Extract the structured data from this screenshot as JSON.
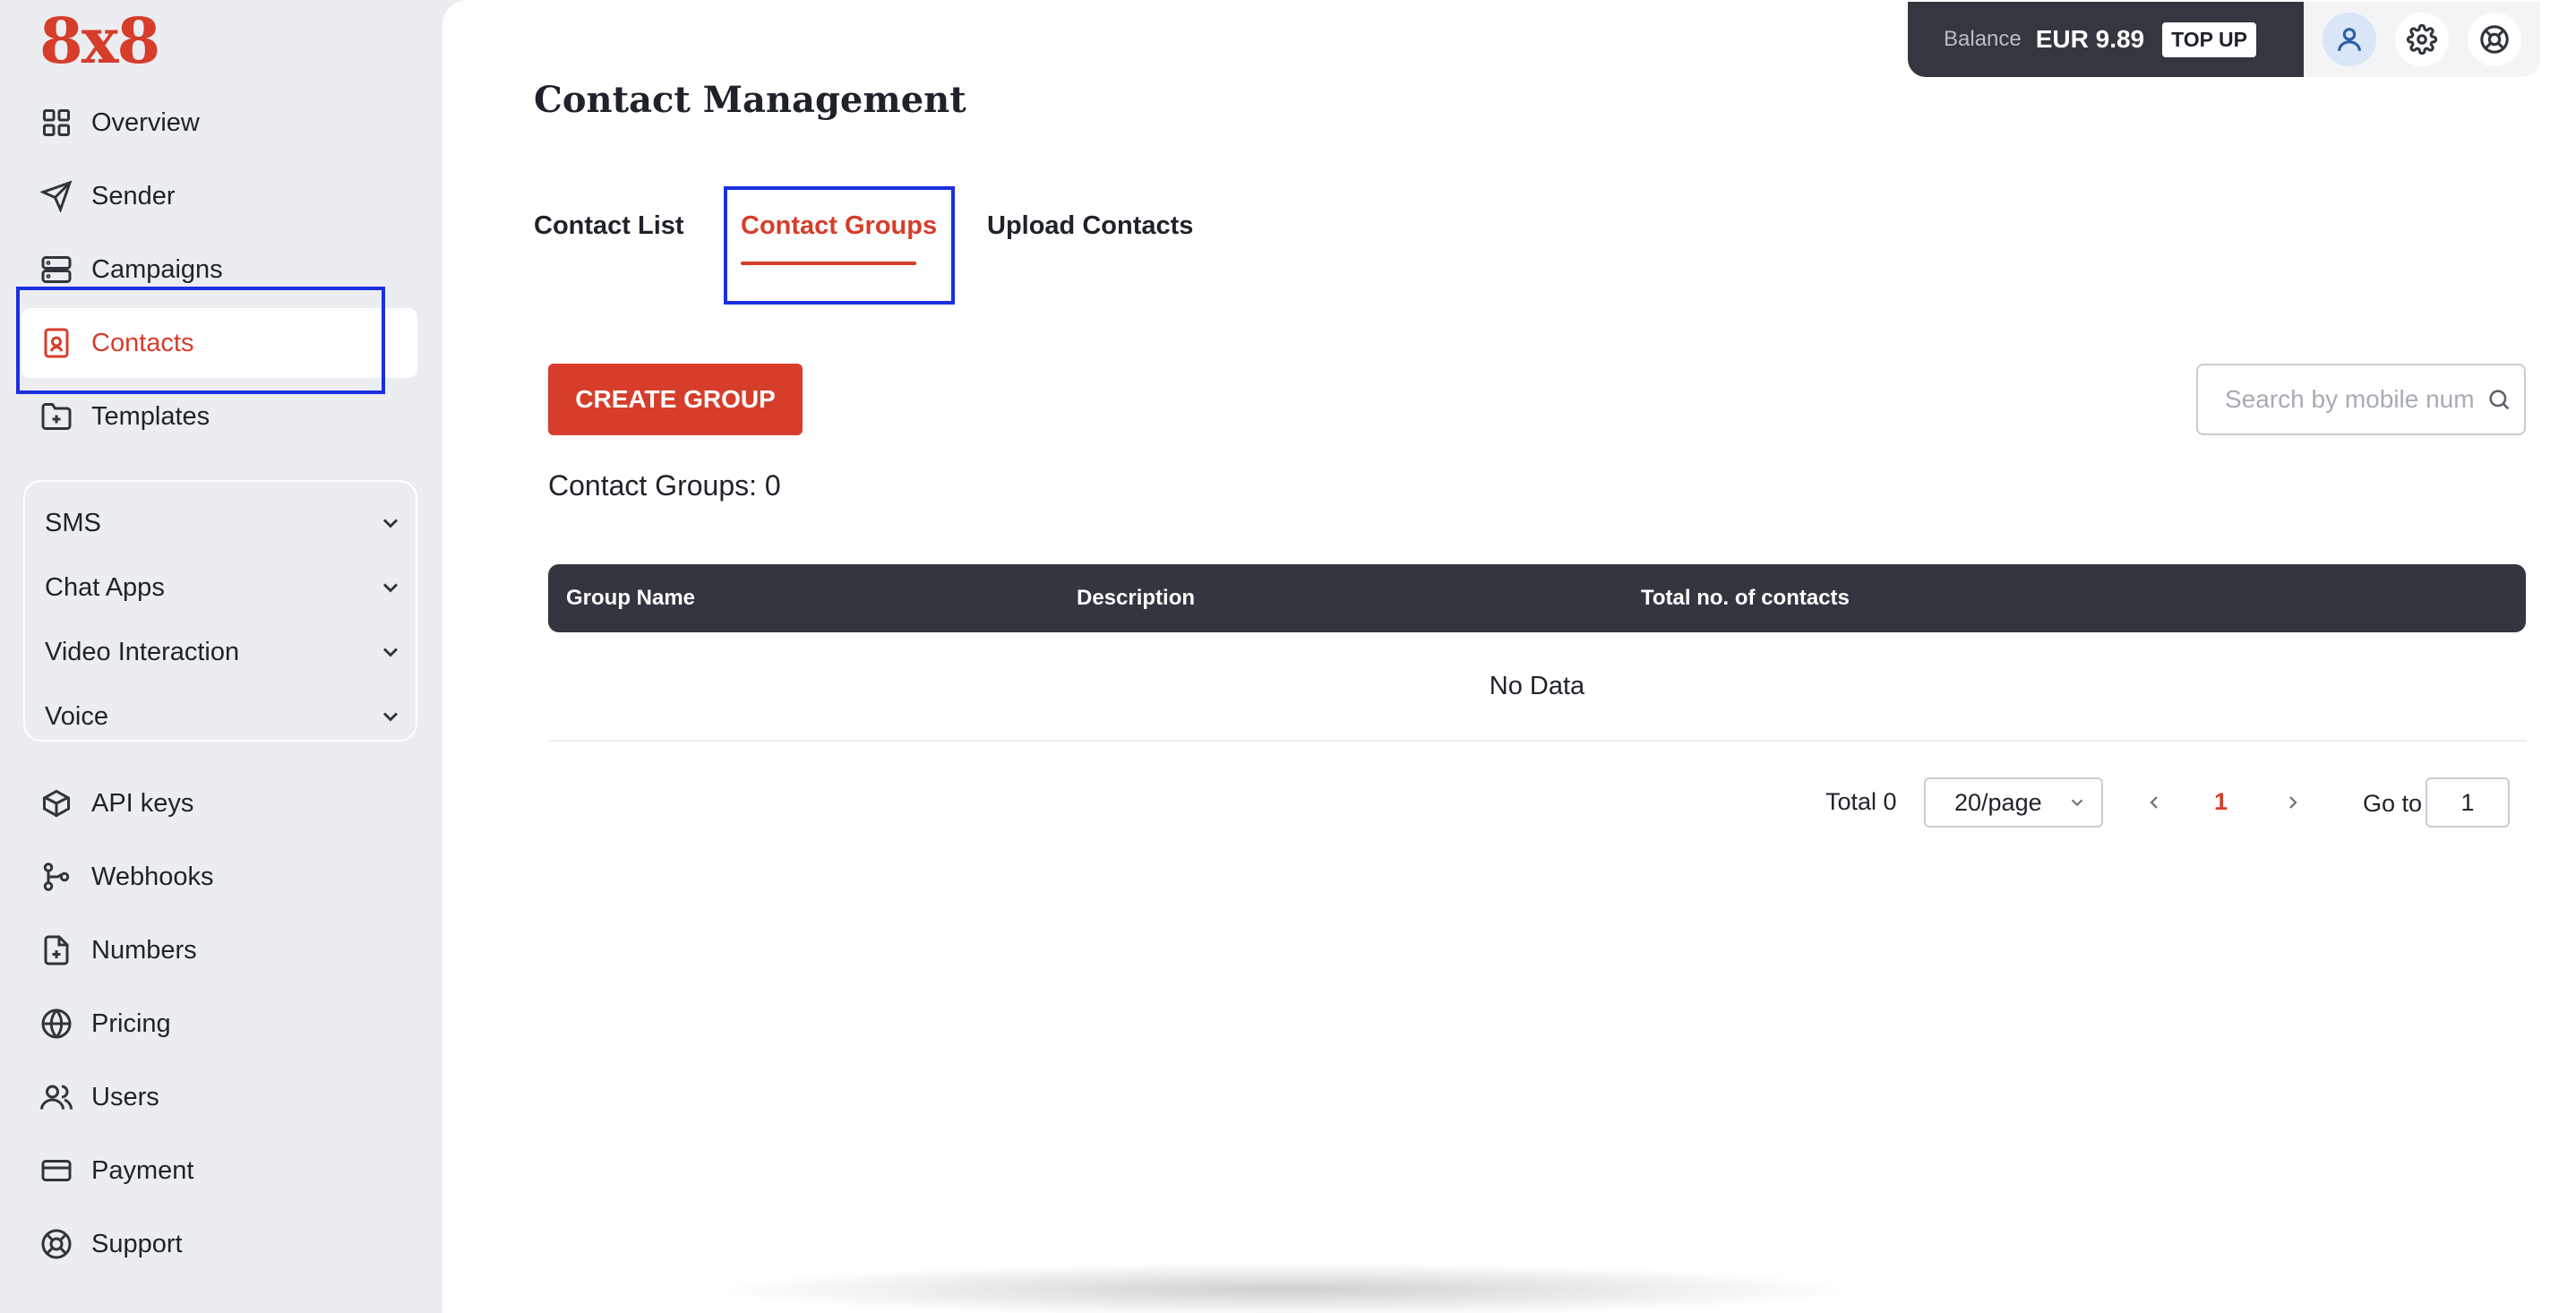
{
  "brand": {
    "logo_text": "8x8",
    "brand_color": "#d63d2b"
  },
  "sidebar": {
    "items": [
      {
        "label": "Overview",
        "icon": "grid-icon",
        "active": false
      },
      {
        "label": "Sender",
        "icon": "send-icon",
        "active": false
      },
      {
        "label": "Campaigns",
        "icon": "server-icon",
        "active": false
      },
      {
        "label": "Contacts",
        "icon": "contact-book-icon",
        "active": true
      },
      {
        "label": "Templates",
        "icon": "folder-plus-icon",
        "active": false
      }
    ],
    "groups": [
      {
        "label": "SMS",
        "icon": "chevron-down-icon"
      },
      {
        "label": "Chat Apps",
        "icon": "chevron-down-icon"
      },
      {
        "label": "Video Interaction",
        "icon": "chevron-down-icon"
      },
      {
        "label": "Voice",
        "icon": "chevron-down-icon"
      }
    ],
    "bottom_items": [
      {
        "label": "API keys",
        "icon": "package-icon"
      },
      {
        "label": "Webhooks",
        "icon": "git-branch-icon"
      },
      {
        "label": "Numbers",
        "icon": "file-plus-icon"
      },
      {
        "label": "Pricing",
        "icon": "globe-icon"
      },
      {
        "label": "Users",
        "icon": "users-icon"
      },
      {
        "label": "Payment",
        "icon": "credit-card-icon"
      },
      {
        "label": "Support",
        "icon": "life-buoy-icon"
      }
    ]
  },
  "topbar": {
    "balance_label": "Balance",
    "balance_value": "EUR 9.89",
    "topup_label": "TOP UP",
    "icons": [
      "user-icon",
      "gear-icon",
      "life-buoy-icon"
    ]
  },
  "main": {
    "title": "Contact Management",
    "tabs": [
      {
        "label": "Contact List",
        "active": false
      },
      {
        "label": "Contact Groups",
        "active": true
      },
      {
        "label": "Upload Contacts",
        "active": false
      }
    ],
    "create_button": "CREATE GROUP",
    "search_placeholder": "Search by mobile num",
    "groups_count": "Contact Groups: 0",
    "table": {
      "columns": [
        "Group Name",
        "Description",
        "Total no. of contacts"
      ],
      "empty_text": "No Data"
    },
    "pagination": {
      "total": "Total 0",
      "page_size": "20/page",
      "current_page": "1",
      "goto_label": "Go to",
      "goto_value": "1"
    }
  },
  "highlight_color": "#1a2fe0"
}
